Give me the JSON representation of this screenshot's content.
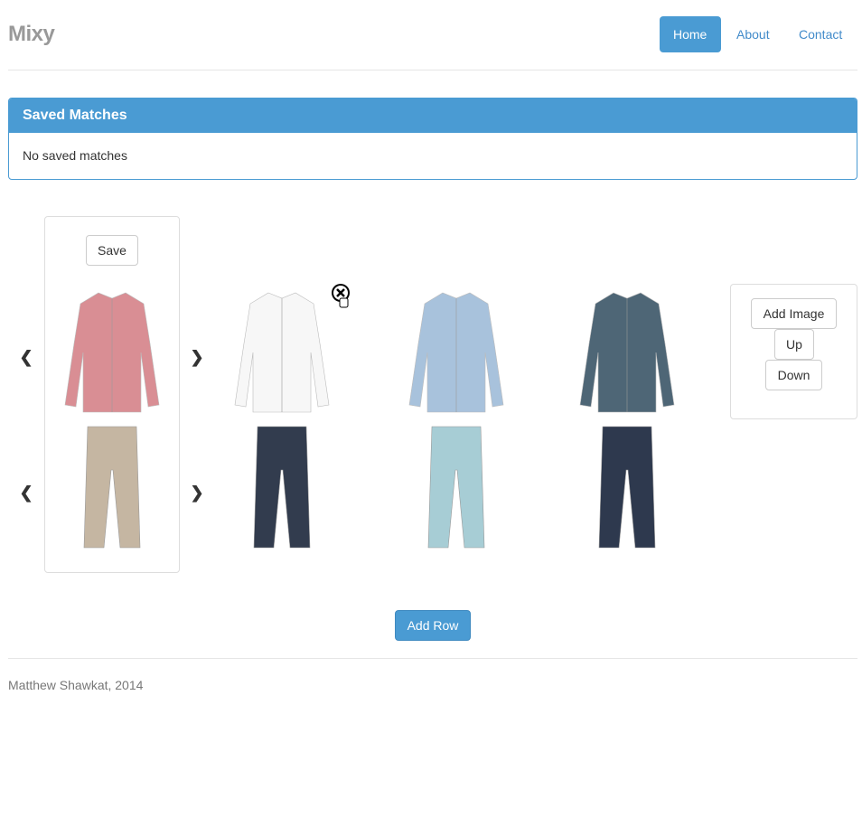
{
  "brand": "Mixy",
  "nav": [
    {
      "label": "Home",
      "active": true
    },
    {
      "label": "About"
    },
    {
      "label": "Contact"
    }
  ],
  "saved": {
    "title": "Saved Matches",
    "empty": "No saved matches"
  },
  "save_label": "Save",
  "controls": {
    "add_image": "Add Image",
    "up": "Up",
    "down": "Down"
  },
  "add_row": "Add Row",
  "footer": "Matthew Shawkat, 2014",
  "shirts": [
    {
      "name": "pink-plaid-shirt",
      "color": "#d98e94"
    },
    {
      "name": "white-shirt",
      "color": "#f7f7f7"
    },
    {
      "name": "light-blue-shirt",
      "color": "#a8c2dc"
    },
    {
      "name": "denim-shirt",
      "color": "#4e6676"
    }
  ],
  "pants": [
    {
      "name": "khaki-pants",
      "color": "#c5b6a2"
    },
    {
      "name": "navy-pants",
      "color": "#323c4e"
    },
    {
      "name": "light-teal-pants",
      "color": "#a7cdd5"
    },
    {
      "name": "dark-denim-pants",
      "color": "#2e394e"
    }
  ]
}
